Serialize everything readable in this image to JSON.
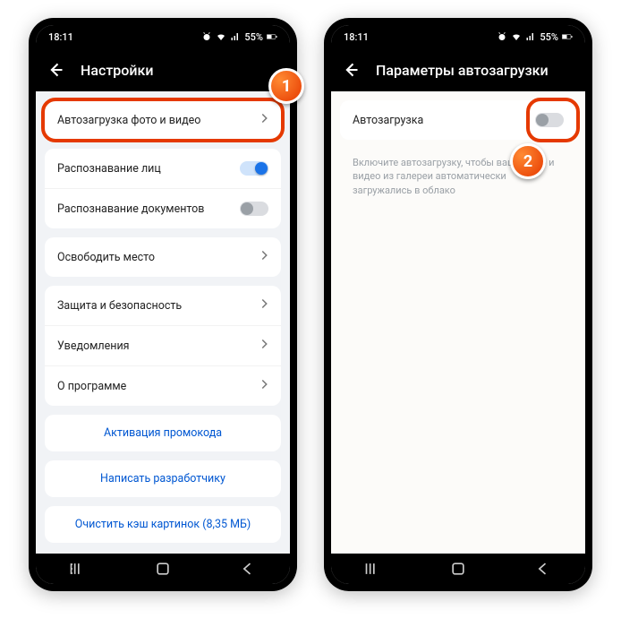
{
  "status": {
    "time": "18:11",
    "battery": "55%"
  },
  "screen1": {
    "title": "Настройки",
    "rows": {
      "autoload": "Автозагрузка фото и видео",
      "faces": "Распознавание лиц",
      "docs": "Распознавание документов",
      "freespace": "Освободить место",
      "security": "Защита и безопасность",
      "notifications": "Уведомления",
      "about": "О программе"
    },
    "links": {
      "promo": "Активация промокода",
      "dev": "Написать разработчику",
      "cache": "Очистить кэш картинок (8,35 МБ)"
    }
  },
  "screen2": {
    "title": "Параметры автозагрузки",
    "row": "Автозагрузка",
    "hint": "Включите автозагрузку, чтобы ваши фото и видео из галереи автоматически загружались в облако"
  },
  "badges": {
    "one": "1",
    "two": "2"
  }
}
